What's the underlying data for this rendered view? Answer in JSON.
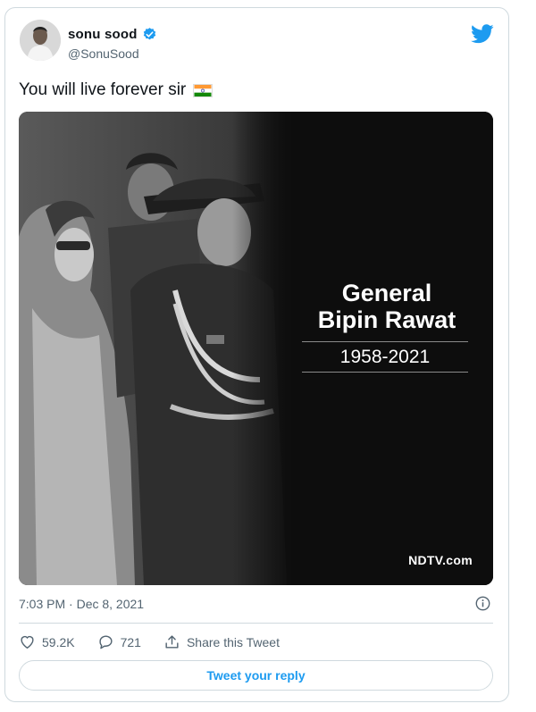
{
  "tweet": {
    "author_name": "sonu sood",
    "handle": "@SonuSood",
    "text": "You will live forever sir",
    "timestamp": "7:03 PM · Dec 8, 2021"
  },
  "media": {
    "title_line1": "General",
    "title_line2": "Bipin Rawat",
    "years": "1958-2021",
    "source": "NDTV.com"
  },
  "actions": {
    "likes": "59.2K",
    "replies": "721",
    "share_label": "Share this Tweet"
  },
  "reply_button_label": "Tweet your reply",
  "colors": {
    "accent": "#1d9bf0",
    "muted": "#536471",
    "border": "#cfd9de"
  },
  "icons": [
    "verified-badge-icon",
    "twitter-bird-icon",
    "india-flag-icon",
    "info-icon",
    "heart-icon",
    "reply-bubble-icon",
    "share-icon"
  ]
}
